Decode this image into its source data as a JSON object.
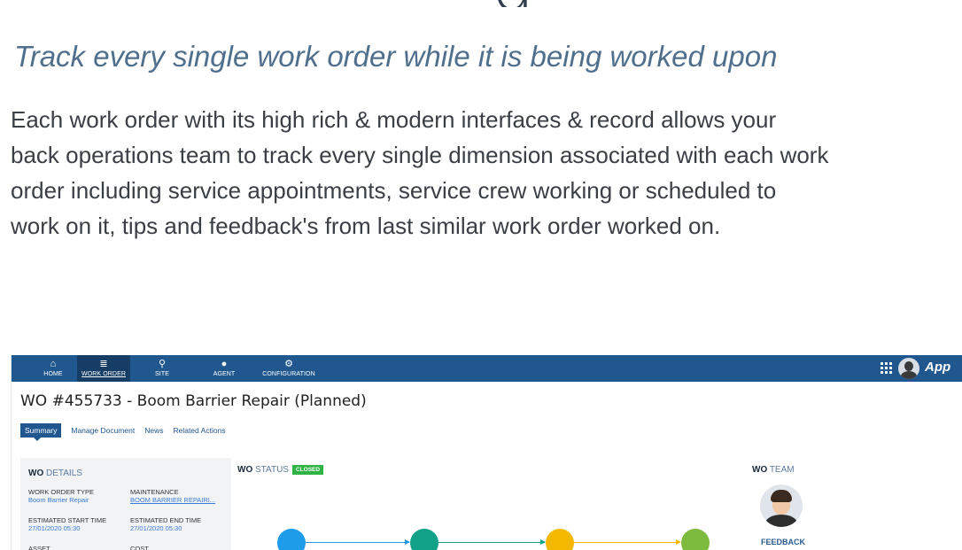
{
  "hero": {
    "big_glyph": "g",
    "tagline": "Track every single work order while it is being worked upon",
    "description_lines": [
      "Each work order with its high rich & modern interfaces & record allows your",
      "back operations team to track every single dimension associated with each work",
      "order including service appointments, service crew working or scheduled to",
      "work on it, tips and feedback's from last similar work order worked on."
    ]
  },
  "app": {
    "nav": [
      {
        "label": "HOME",
        "icon": "home-icon"
      },
      {
        "label": "WORK ORDER",
        "icon": "work-order-icon"
      },
      {
        "label": "SITE",
        "icon": "map-pin-icon"
      },
      {
        "label": "AGENT",
        "icon": "user-icon"
      },
      {
        "label": "CONFIGURATION",
        "icon": "configuration-icon"
      }
    ],
    "brand": "App",
    "title": "WO #455733 - Boom Barrier Repair (Planned)",
    "tabs": [
      "Summary",
      "Manage Document",
      "News",
      "Related Actions"
    ],
    "details": {
      "heading_bold": "WO",
      "heading_rest": " DETAILS",
      "fields": [
        {
          "key": "WORK ORDER TYPE",
          "value": "Boom Barrier Repair"
        },
        {
          "key": "MAINTENANCE",
          "value": "BOOM BARRIER REPAIRI..."
        },
        {
          "key": "ESTIMATED START TIME",
          "value": "27/01/2020 05:30"
        },
        {
          "key": "ESTIMATED END TIME",
          "value": "27/01/2020 05:30"
        },
        {
          "key": "ASSET",
          "value": ""
        },
        {
          "key": "COST",
          "value": ""
        }
      ]
    },
    "status": {
      "heading_bold": "WO",
      "heading_rest": " STATUS",
      "badge": "CLOSED",
      "badge_color": "#2fb344",
      "timeline_colors": [
        "#1e9be9",
        "#11a088",
        "#f5b800",
        "#7dbb3e"
      ]
    },
    "team": {
      "heading_bold": "WO",
      "heading_rest": " TEAM",
      "feedback": "FEEDBACK"
    },
    "colors": {
      "topbar": "#21578f",
      "accent_link": "#3a7bd5"
    }
  }
}
